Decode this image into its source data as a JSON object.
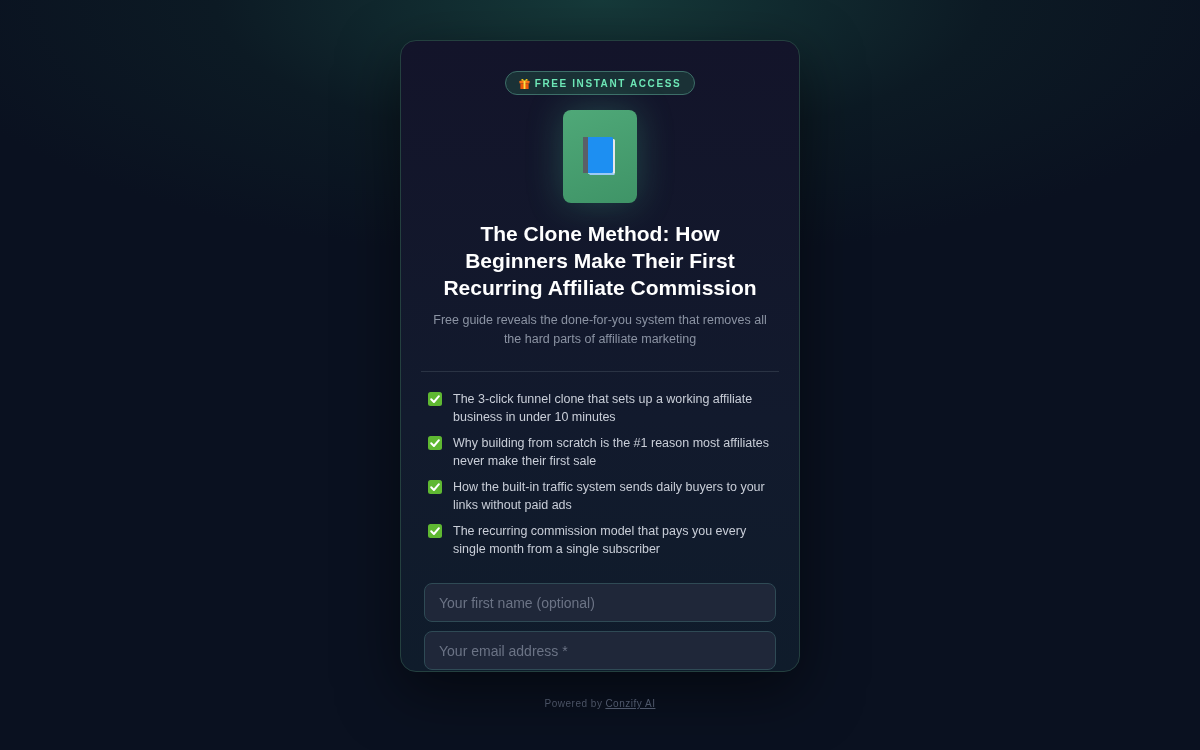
{
  "badge": {
    "label": "FREE INSTANT ACCESS"
  },
  "title": "The Clone Method: How Beginners Make Their First Recurring Affiliate Commission",
  "subtitle": "Free guide reveals the done-for-you system that removes all the hard parts of affiliate marketing",
  "benefits": [
    "The 3-click funnel clone that sets up a working affiliate business in under 10 minutes",
    "Why building from scratch is the #1 reason most affiliates never make their first sale",
    "How the built-in traffic system sends daily buyers to your links without paid ads",
    "The recurring commission model that pays you every single month from a single subscriber"
  ],
  "form": {
    "fields": [
      {
        "placeholder": "Your first name (optional)"
      },
      {
        "placeholder": "Your email address *"
      }
    ]
  },
  "footer": {
    "text": "Powered by",
    "link": "Conzify AI"
  }
}
